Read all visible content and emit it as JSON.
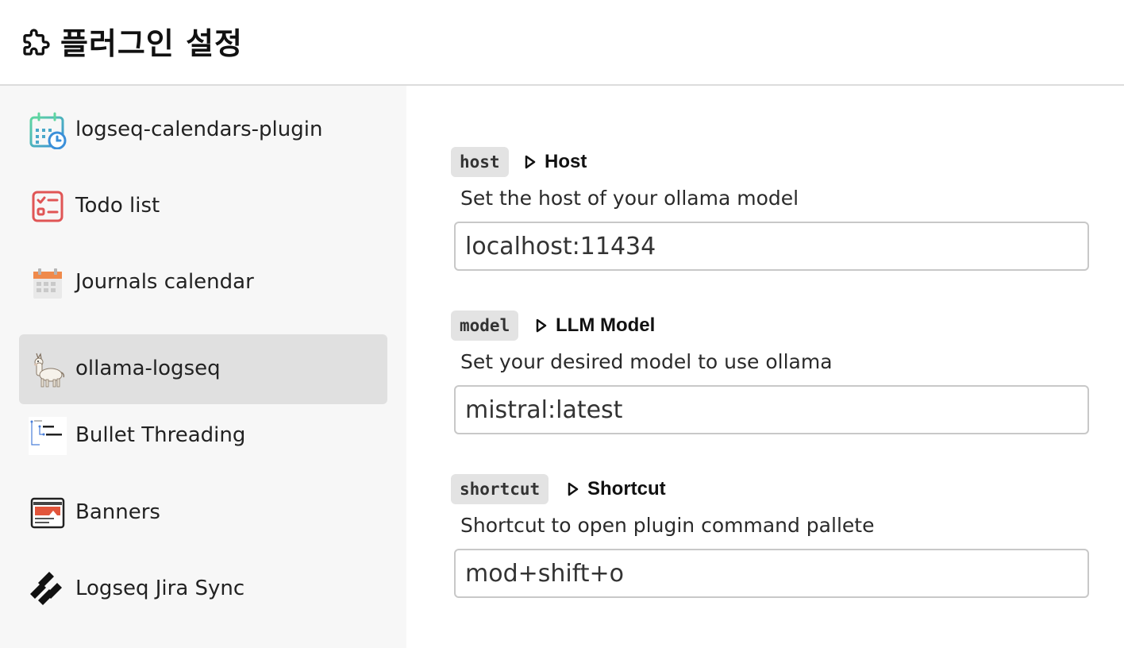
{
  "header": {
    "title": "플러그인 설정",
    "icon": "puzzle-icon"
  },
  "sidebar": {
    "items": [
      {
        "label": "logseq-calendars-plugin",
        "icon": "calendar-clock-icon",
        "active": false
      },
      {
        "label": "Todo list",
        "icon": "checklist-icon",
        "active": false
      },
      {
        "label": "Journals calendar",
        "icon": "calendar-icon",
        "active": false
      },
      {
        "label": "ollama-logseq",
        "icon": "llama-icon",
        "active": true
      },
      {
        "label": "Bullet Threading",
        "icon": "bullet-threading-icon",
        "active": false
      },
      {
        "label": "Banners",
        "icon": "banner-icon",
        "active": false
      },
      {
        "label": "Logseq Jira Sync",
        "icon": "jira-icon",
        "active": false
      }
    ]
  },
  "settings": [
    {
      "key": "host",
      "title": "Host",
      "description": "Set the host of your ollama model",
      "value": "localhost:11434"
    },
    {
      "key": "model",
      "title": "LLM Model",
      "description": "Set your desired model to use ollama",
      "value": "mistral:latest"
    },
    {
      "key": "shortcut",
      "title": "Shortcut",
      "description": "Shortcut to open plugin command pallete",
      "value": "mod+shift+o"
    }
  ],
  "colors": {
    "sidebar_bg": "#f7f7f7",
    "active_item_bg": "#e0e0e0",
    "key_chip_bg": "#e3e3e3",
    "field_border": "#c8c8c8"
  }
}
